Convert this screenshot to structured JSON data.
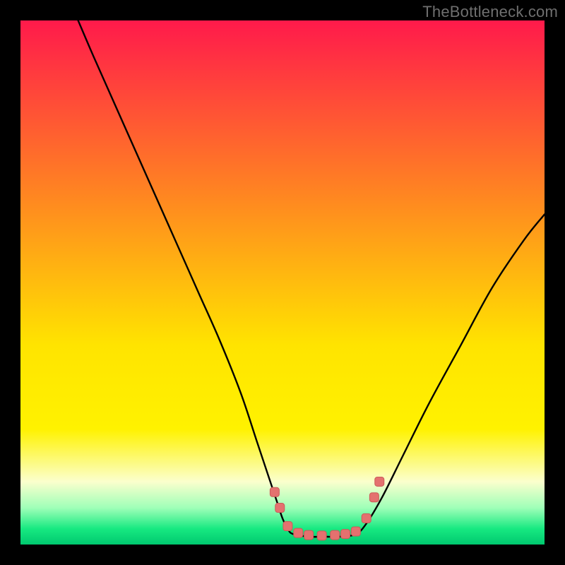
{
  "watermark": "TheBottleneck.com",
  "colors": {
    "top": "#ff1a4b",
    "mid1": "#ff8b1f",
    "mid2": "#ffe400",
    "ylw_brt": "#fff200",
    "low_pale": "#fbffcd",
    "grn_soft": "#9fffb8",
    "grn": "#17e981",
    "grn_deep": "#00c96f",
    "curve": "#000000",
    "dot_fill": "#e4716f",
    "dot_stroke": "#cc5a59"
  },
  "chart_data": {
    "type": "line",
    "title": "",
    "xlabel": "",
    "ylabel": "",
    "xlim": [
      0,
      100
    ],
    "ylim": [
      0,
      100
    ],
    "series": [
      {
        "name": "left-curve",
        "x": [
          11,
          14,
          18,
          22,
          26,
          30,
          34,
          38,
          42,
          45,
          47,
          49,
          50,
          51,
          52
        ],
        "y": [
          100,
          93,
          84,
          75,
          66,
          57,
          48,
          39,
          29,
          20,
          14,
          8,
          5,
          3,
          2
        ]
      },
      {
        "name": "valley-floor",
        "x": [
          52,
          55,
          58,
          61,
          64
        ],
        "y": [
          2,
          1.5,
          1.5,
          1.5,
          2
        ]
      },
      {
        "name": "right-curve",
        "x": [
          64,
          66,
          69,
          73,
          78,
          84,
          90,
          96,
          100
        ],
        "y": [
          2,
          4,
          9,
          17,
          27,
          38,
          49,
          58,
          63
        ]
      }
    ],
    "markers": {
      "name": "dots",
      "shape": "rounded-square",
      "points": [
        {
          "x": 48.5,
          "y": 10
        },
        {
          "x": 49.5,
          "y": 7
        },
        {
          "x": 51.0,
          "y": 3.5
        },
        {
          "x": 53.0,
          "y": 2.2
        },
        {
          "x": 55.0,
          "y": 1.8
        },
        {
          "x": 57.5,
          "y": 1.7
        },
        {
          "x": 60.0,
          "y": 1.8
        },
        {
          "x": 62.0,
          "y": 2.0
        },
        {
          "x": 64.0,
          "y": 2.5
        },
        {
          "x": 66.0,
          "y": 5.0
        },
        {
          "x": 67.5,
          "y": 9.0
        },
        {
          "x": 68.5,
          "y": 12.0
        }
      ]
    }
  }
}
